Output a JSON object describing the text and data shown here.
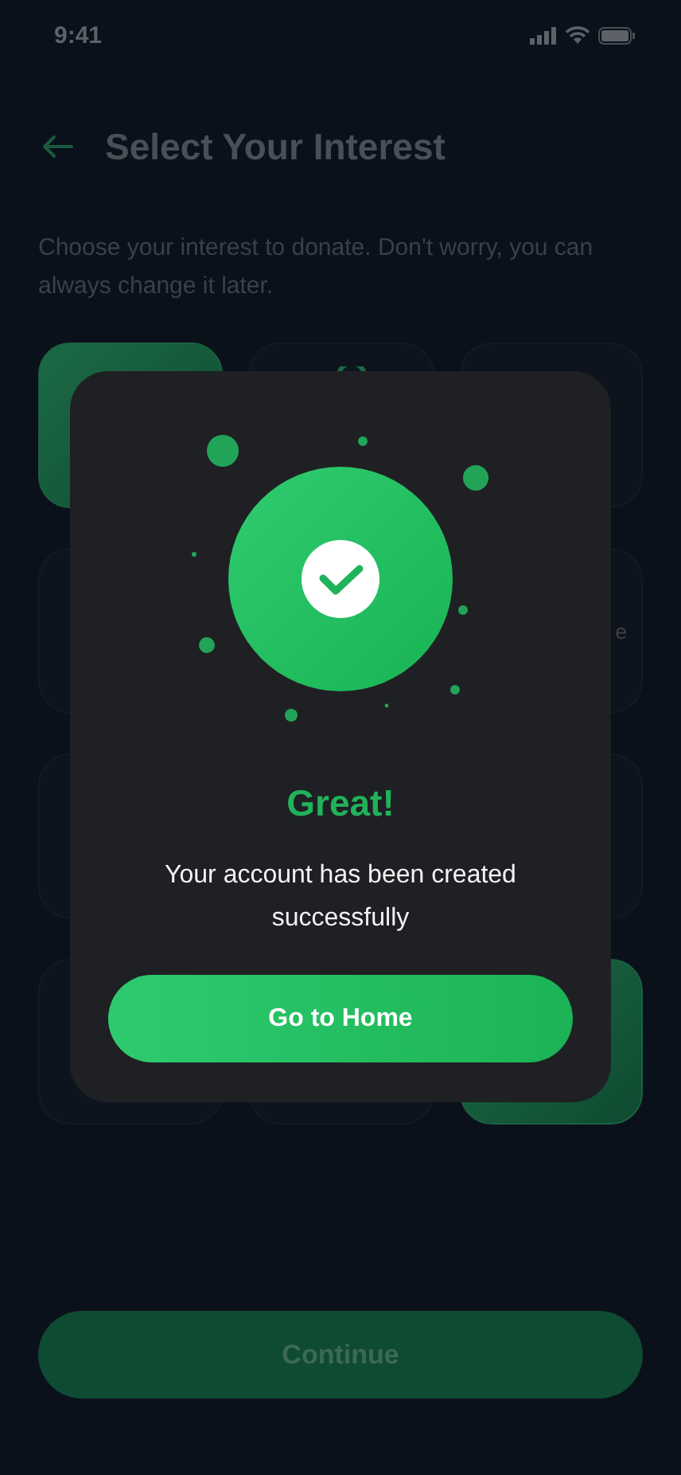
{
  "status_bar": {
    "time": "9:41"
  },
  "header": {
    "title": "Select Your Interest"
  },
  "description": "Choose your interest to donate. Don't worry, you can always change it later.",
  "interests": [
    {
      "selected": true
    },
    {
      "selected": false,
      "peek_icon": true
    },
    {
      "selected": false
    },
    {
      "selected": false
    },
    {
      "selected": false,
      "label": "e"
    },
    {
      "selected": false
    },
    {
      "selected": false
    },
    {
      "selected": false
    },
    {
      "selected": false
    },
    {
      "selected": true
    }
  ],
  "continue_button": {
    "label": "Continue",
    "disabled": true
  },
  "dialog": {
    "title": "Great!",
    "message": "Your account has been created successfully",
    "button": "Go to Home"
  }
}
